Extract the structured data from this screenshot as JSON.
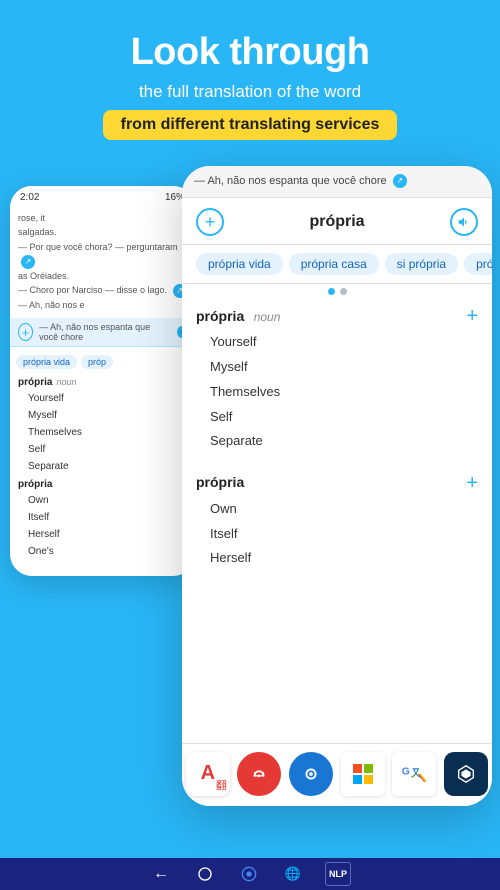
{
  "header": {
    "headline": "Look through",
    "subheadline": "the full translation of the word",
    "highlight": "from different translating services"
  },
  "phone_back": {
    "status_time": "2:02",
    "status_signal": "▲▲▲",
    "status_battery": "16%",
    "reading_lines": [
      "rose, it",
      "salgadas.",
      "— Por que você chora? — perguntaram",
      "as Oréiades.",
      "— Choro por Narciso — disse o lago."
    ],
    "bar_text": "— Ah, não nos espanta que você chore",
    "chips": [
      "própria vida",
      "próp"
    ],
    "dict_word": "própria",
    "dict_pos": "noun",
    "dict_items": [
      "Yourself",
      "Myself",
      "Themselves",
      "Self",
      "Separate"
    ],
    "dict_word2": "própria",
    "dict_items2": [
      "Own",
      "Itself",
      "Herself",
      "One's"
    ]
  },
  "phone_front": {
    "reading_lines": [
      {
        "text": "— Ah, não nos espanta que você chore",
        "icon": true
      }
    ],
    "dict_word": "própria",
    "add_btn_label": "+",
    "sound_icon": "🔊",
    "chips": [
      "própria vida",
      "própria casa",
      "si própria",
      "própria c"
    ],
    "dots": [
      true,
      false
    ],
    "entries": [
      {
        "word": "própria",
        "pos": "noun",
        "meanings": [
          "Yourself",
          "Myself",
          "Themselves",
          "Self",
          "Separate"
        ]
      },
      {
        "word": "própria",
        "pos": "",
        "meanings": [
          "Own",
          "Itself",
          "Herself"
        ]
      }
    ]
  },
  "toolbar": {
    "icons": [
      {
        "name": "abbyy",
        "label": "A翻",
        "bg": "#e53935",
        "color": "#fff"
      },
      {
        "name": "reverso",
        "label": "↺",
        "bg": "#e53935",
        "color": "#fff"
      },
      {
        "name": "lingvo",
        "label": "◎",
        "bg": "#1976d2",
        "color": "#fff"
      },
      {
        "name": "microsoft",
        "label": "⊞",
        "bg": "#fff",
        "color": "#f25022"
      },
      {
        "name": "google-translate",
        "label": "G",
        "bg": "#fff",
        "color": "#4285f4"
      },
      {
        "name": "deepl",
        "label": "▶",
        "bg": "#0a2e52",
        "color": "#fff"
      }
    ]
  },
  "system_bar": {
    "icons": [
      "←",
      "⬤",
      "▣",
      "🌐",
      "NLP"
    ]
  }
}
